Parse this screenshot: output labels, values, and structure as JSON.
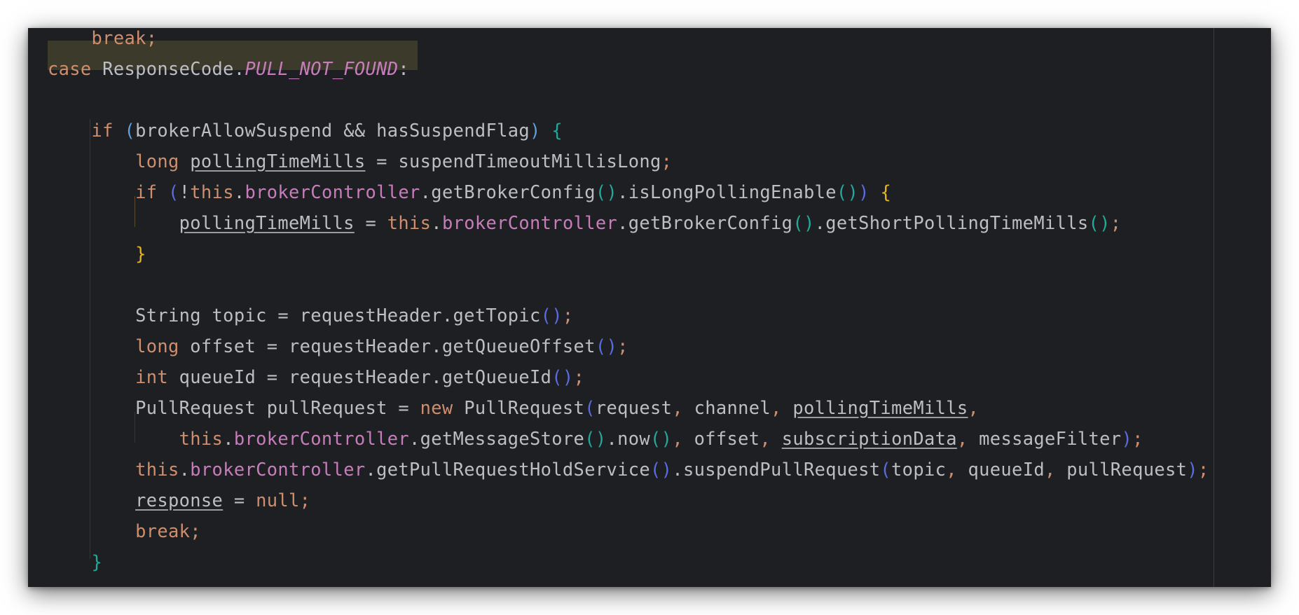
{
  "editor": {
    "language": "java",
    "highlight_color": "#3b3a2b",
    "background_color": "#1e1f22",
    "lines": [
      {
        "tokens": [
          {
            "t": "    "
          },
          {
            "t": "break;",
            "c": "kw"
          }
        ]
      },
      {
        "tokens": [
          {
            "t": "case",
            "c": "kw"
          },
          {
            "t": " ResponseCode."
          },
          {
            "t": "PULL_NOT_FOUND",
            "c": "fldi"
          },
          {
            "t": ":"
          }
        ]
      },
      {
        "tokens": []
      },
      {
        "tokens": [
          {
            "t": "    "
          },
          {
            "t": "if",
            "c": "kw"
          },
          {
            "t": " "
          },
          {
            "t": "(",
            "c": "pa"
          },
          {
            "t": "brokerAllowSuspend && hasSuspendFlag"
          },
          {
            "t": ")",
            "c": "pa"
          },
          {
            "t": " "
          },
          {
            "t": "{",
            "c": "pb"
          }
        ]
      },
      {
        "tokens": [
          {
            "t": "        "
          },
          {
            "t": "long",
            "c": "kw"
          },
          {
            "t": " "
          },
          {
            "t": "pollingTimeMills",
            "c": "ul"
          },
          {
            "t": " = suspendTimeoutMillisLong"
          },
          {
            "t": ";",
            "c": "kw"
          }
        ]
      },
      {
        "tokens": [
          {
            "t": "        "
          },
          {
            "t": "if",
            "c": "kw"
          },
          {
            "t": " "
          },
          {
            "t": "(",
            "c": "pd"
          },
          {
            "t": "!"
          },
          {
            "t": "this",
            "c": "kw"
          },
          {
            "t": "."
          },
          {
            "t": "brokerController",
            "c": "fld"
          },
          {
            "t": ".getBrokerConfig"
          },
          {
            "t": "()",
            "c": "pb"
          },
          {
            "t": ".isLongPollingEnable"
          },
          {
            "t": "()",
            "c": "pb"
          },
          {
            "t": ")",
            "c": "pd"
          },
          {
            "t": " "
          },
          {
            "t": "{",
            "c": "pc"
          }
        ]
      },
      {
        "tokens": [
          {
            "t": "            "
          },
          {
            "t": "pollingTimeMills",
            "c": "ul"
          },
          {
            "t": " = "
          },
          {
            "t": "this",
            "c": "kw"
          },
          {
            "t": "."
          },
          {
            "t": "brokerController",
            "c": "fld"
          },
          {
            "t": ".getBrokerConfig"
          },
          {
            "t": "()",
            "c": "pb"
          },
          {
            "t": ".getShortPollingTimeMills"
          },
          {
            "t": "()",
            "c": "pb"
          },
          {
            "t": ";",
            "c": "kw"
          }
        ]
      },
      {
        "tokens": [
          {
            "t": "        "
          },
          {
            "t": "}",
            "c": "pc"
          }
        ]
      },
      {
        "tokens": []
      },
      {
        "tokens": [
          {
            "t": "        String topic = requestHeader.getTopic"
          },
          {
            "t": "()",
            "c": "pd"
          },
          {
            "t": ";",
            "c": "kw"
          }
        ]
      },
      {
        "tokens": [
          {
            "t": "        "
          },
          {
            "t": "long",
            "c": "kw"
          },
          {
            "t": " offset = requestHeader.getQueueOffset"
          },
          {
            "t": "()",
            "c": "pd"
          },
          {
            "t": ";",
            "c": "kw"
          }
        ]
      },
      {
        "tokens": [
          {
            "t": "        "
          },
          {
            "t": "int",
            "c": "kw"
          },
          {
            "t": " queueId = requestHeader.getQueueId"
          },
          {
            "t": "()",
            "c": "pd"
          },
          {
            "t": ";",
            "c": "kw"
          }
        ]
      },
      {
        "tokens": [
          {
            "t": "        PullRequest pullRequest = "
          },
          {
            "t": "new",
            "c": "kw"
          },
          {
            "t": " PullRequest"
          },
          {
            "t": "(",
            "c": "pd"
          },
          {
            "t": "request"
          },
          {
            "t": ",",
            "c": "kw"
          },
          {
            "t": " channel"
          },
          {
            "t": ",",
            "c": "kw"
          },
          {
            "t": " "
          },
          {
            "t": "pollingTimeMills",
            "c": "ul"
          },
          {
            "t": ",",
            "c": "kw"
          }
        ]
      },
      {
        "tokens": [
          {
            "t": "            "
          },
          {
            "t": "this",
            "c": "kw"
          },
          {
            "t": "."
          },
          {
            "t": "brokerController",
            "c": "fld"
          },
          {
            "t": ".getMessageStore"
          },
          {
            "t": "()",
            "c": "pb"
          },
          {
            "t": ".now"
          },
          {
            "t": "()",
            "c": "pb"
          },
          {
            "t": ",",
            "c": "kw"
          },
          {
            "t": " offset"
          },
          {
            "t": ",",
            "c": "kw"
          },
          {
            "t": " "
          },
          {
            "t": "subscriptionData",
            "c": "ul"
          },
          {
            "t": ",",
            "c": "kw"
          },
          {
            "t": " messageFilter"
          },
          {
            "t": ")",
            "c": "pd"
          },
          {
            "t": ";",
            "c": "kw"
          }
        ]
      },
      {
        "tokens": [
          {
            "t": "        "
          },
          {
            "t": "this",
            "c": "kw"
          },
          {
            "t": "."
          },
          {
            "t": "brokerController",
            "c": "fld"
          },
          {
            "t": ".getPullRequestHoldService"
          },
          {
            "t": "()",
            "c": "pd"
          },
          {
            "t": ".suspendPullRequest"
          },
          {
            "t": "(",
            "c": "pd"
          },
          {
            "t": "topic"
          },
          {
            "t": ",",
            "c": "kw"
          },
          {
            "t": " queueId"
          },
          {
            "t": ",",
            "c": "kw"
          },
          {
            "t": " pullRequest"
          },
          {
            "t": ")",
            "c": "pd"
          },
          {
            "t": ";",
            "c": "kw"
          }
        ]
      },
      {
        "tokens": [
          {
            "t": "        "
          },
          {
            "t": "response",
            "c": "ul"
          },
          {
            "t": " = "
          },
          {
            "t": "null",
            "c": "kw"
          },
          {
            "t": ";",
            "c": "kw"
          }
        ]
      },
      {
        "tokens": [
          {
            "t": "        "
          },
          {
            "t": "break;",
            "c": "kw"
          }
        ]
      },
      {
        "tokens": [
          {
            "t": "    "
          },
          {
            "t": "}",
            "c": "pb"
          }
        ]
      }
    ]
  }
}
